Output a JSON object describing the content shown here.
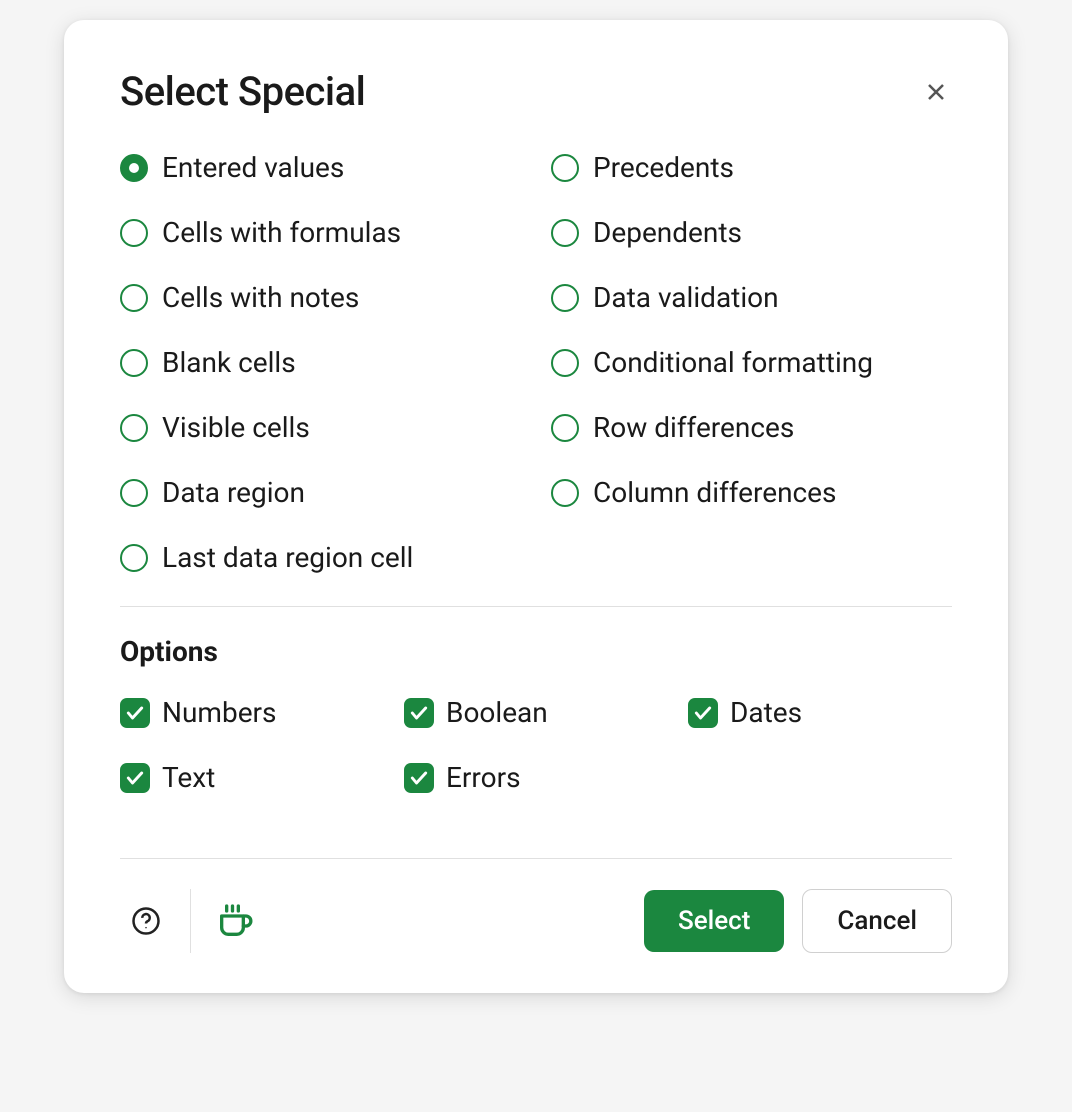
{
  "dialog": {
    "title": "Select Special"
  },
  "radios": {
    "selected_index": 0,
    "items": [
      {
        "label": "Entered values"
      },
      {
        "label": "Cells with formulas"
      },
      {
        "label": "Cells with notes"
      },
      {
        "label": "Blank cells"
      },
      {
        "label": "Visible cells"
      },
      {
        "label": "Data region"
      },
      {
        "label": "Last data region cell"
      },
      {
        "label": "Precedents"
      },
      {
        "label": "Dependents"
      },
      {
        "label": "Data validation"
      },
      {
        "label": "Conditional formatting"
      },
      {
        "label": "Row differences"
      },
      {
        "label": "Column differences"
      }
    ]
  },
  "options": {
    "heading": "Options",
    "items": [
      {
        "label": "Numbers",
        "checked": true
      },
      {
        "label": "Text",
        "checked": true
      },
      {
        "label": "Boolean",
        "checked": true
      },
      {
        "label": "Errors",
        "checked": true
      },
      {
        "label": "Dates",
        "checked": true
      }
    ]
  },
  "buttons": {
    "primary": "Select",
    "secondary": "Cancel"
  }
}
